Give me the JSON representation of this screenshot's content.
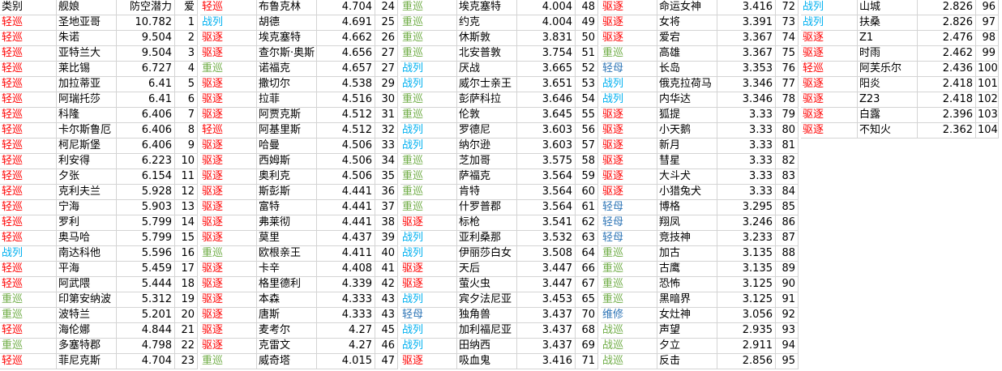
{
  "headers": [
    "类别",
    "舰娘",
    "防空潜力",
    "爱"
  ],
  "colors": {
    "轻巡": "#ff0000",
    "重巡": "#70ad47",
    "战列": "#00b0f0",
    "驱逐": "#ff0000",
    "轻母": "#2e75b6",
    "维修": "#2e75b6"
  },
  "blocks": [
    {
      "header": true,
      "rows": [
        [
          "轻巡",
          "圣地亚哥",
          "10.782",
          "1"
        ],
        [
          "轻巡",
          "朱诺",
          "9.504",
          "2"
        ],
        [
          "轻巡",
          "亚特兰大",
          "9.504",
          "3"
        ],
        [
          "轻巡",
          "莱比锡",
          "6.727",
          "4"
        ],
        [
          "轻巡",
          "加拉蒂亚",
          "6.41",
          "5"
        ],
        [
          "轻巡",
          "阿瑞托莎",
          "6.41",
          "6"
        ],
        [
          "轻巡",
          "科隆",
          "6.406",
          "7"
        ],
        [
          "轻巡",
          "卡尔斯鲁厄",
          "6.406",
          "8"
        ],
        [
          "轻巡",
          "柯尼斯堡",
          "6.406",
          "9"
        ],
        [
          "轻巡",
          "利安得",
          "6.223",
          "10"
        ],
        [
          "轻巡",
          "夕张",
          "6.154",
          "11"
        ],
        [
          "轻巡",
          "克利夫兰",
          "5.928",
          "12"
        ],
        [
          "轻巡",
          "宁海",
          "5.903",
          "13"
        ],
        [
          "轻巡",
          "罗利",
          "5.799",
          "14"
        ],
        [
          "轻巡",
          "奥马哈",
          "5.799",
          "15"
        ],
        [
          "战列",
          "南达科他",
          "5.596",
          "16"
        ],
        [
          "轻巡",
          "平海",
          "5.459",
          "17"
        ],
        [
          "轻巡",
          "阿武隈",
          "5.444",
          "18"
        ],
        [
          "重巡",
          "印第安纳波",
          "5.312",
          "19"
        ],
        [
          "重巡",
          "波特兰",
          "5.201",
          "20"
        ],
        [
          "轻巡",
          "海伦娜",
          "4.844",
          "21"
        ],
        [
          "重巡",
          "多塞特郡",
          "4.798",
          "22"
        ],
        [
          "轻巡",
          "菲尼克斯",
          "4.704",
          "23"
        ]
      ]
    },
    {
      "header": false,
      "rows": [
        [
          "轻巡",
          "布鲁克林",
          "4.704",
          "24"
        ],
        [
          "战列",
          "胡德",
          "4.691",
          "25"
        ],
        [
          "驱逐",
          "埃克塞特",
          "4.662",
          "26"
        ],
        [
          "驱逐",
          "查尔斯·奥斯",
          "4.656",
          "27"
        ],
        [
          "重巡",
          "诺福克",
          "4.657",
          "27"
        ],
        [
          "驱逐",
          "撒切尔",
          "4.538",
          "29"
        ],
        [
          "驱逐",
          "拉菲",
          "4.516",
          "30"
        ],
        [
          "驱逐",
          "阿贾克斯",
          "4.512",
          "31"
        ],
        [
          "轻巡",
          "阿基里斯",
          "4.512",
          "32"
        ],
        [
          "驱逐",
          "哈曼",
          "4.506",
          "33"
        ],
        [
          "驱逐",
          "西姆斯",
          "4.506",
          "34"
        ],
        [
          "驱逐",
          "奥利克",
          "4.506",
          "35"
        ],
        [
          "驱逐",
          "斯彭斯",
          "4.441",
          "36"
        ],
        [
          "驱逐",
          "富特",
          "4.441",
          "37"
        ],
        [
          "驱逐",
          "弗莱彻",
          "4.441",
          "38"
        ],
        [
          "驱逐",
          "莫里",
          "4.437",
          "39"
        ],
        [
          "重巡",
          "欧根亲王",
          "4.411",
          "40"
        ],
        [
          "驱逐",
          "卡辛",
          "4.408",
          "41"
        ],
        [
          "驱逐",
          "格里德利",
          "4.339",
          "42"
        ],
        [
          "驱逐",
          "本森",
          "4.333",
          "43"
        ],
        [
          "驱逐",
          "唐斯",
          "4.333",
          "43"
        ],
        [
          "驱逐",
          "麦考尔",
          "4.27",
          "45"
        ],
        [
          "驱逐",
          "克雷文",
          "4.27",
          "46"
        ],
        [
          "重巡",
          "威奇塔",
          "4.015",
          "47"
        ]
      ]
    },
    {
      "header": false,
      "rows": [
        [
          "重巡",
          "埃克塞特",
          "4.004",
          "48"
        ],
        [
          "重巡",
          "约克",
          "4.004",
          "49"
        ],
        [
          "重巡",
          "休斯敦",
          "3.831",
          "50"
        ],
        [
          "重巡",
          "北安普敦",
          "3.754",
          "51"
        ],
        [
          "战列",
          "厌战",
          "3.665",
          "52"
        ],
        [
          "战列",
          "威尔士亲王",
          "3.651",
          "53"
        ],
        [
          "重巡",
          "彭萨科拉",
          "3.646",
          "54"
        ],
        [
          "重巡",
          "伦敦",
          "3.645",
          "55"
        ],
        [
          "战列",
          "罗德尼",
          "3.603",
          "56"
        ],
        [
          "战列",
          "纳尔逊",
          "3.603",
          "57"
        ],
        [
          "重巡",
          "芝加哥",
          "3.575",
          "58"
        ],
        [
          "重巡",
          "萨福克",
          "3.564",
          "59"
        ],
        [
          "重巡",
          "肯特",
          "3.564",
          "60"
        ],
        [
          "重巡",
          "什罗普郡",
          "3.564",
          "61"
        ],
        [
          "驱逐",
          "标枪",
          "3.541",
          "62"
        ],
        [
          "战列",
          "亚利桑那",
          "3.532",
          "63"
        ],
        [
          "战列",
          "伊丽莎白女",
          "3.508",
          "64"
        ],
        [
          "驱逐",
          "天后",
          "3.447",
          "66"
        ],
        [
          "驱逐",
          "萤火虫",
          "3.447",
          "67"
        ],
        [
          "战列",
          "宾夕法尼亚",
          "3.453",
          "65"
        ],
        [
          "轻母",
          "独角兽",
          "3.437",
          "70"
        ],
        [
          "战列",
          "加利福尼亚",
          "3.437",
          "68"
        ],
        [
          "战列",
          "田纳西",
          "3.437",
          "69"
        ],
        [
          "驱逐",
          "吸血鬼",
          "3.416",
          "71"
        ]
      ]
    },
    {
      "header": false,
      "rows": [
        [
          "驱逐",
          "命运女神",
          "3.416",
          "72"
        ],
        [
          "驱逐",
          "女将",
          "3.391",
          "73"
        ],
        [
          "驱逐",
          "爱宕",
          "3.367",
          "74"
        ],
        [
          "重巡",
          "高雄",
          "3.367",
          "75"
        ],
        [
          "轻母",
          "长岛",
          "3.353",
          "76"
        ],
        [
          "战列",
          "俄克拉荷马",
          "3.346",
          "77"
        ],
        [
          "战列",
          "内华达",
          "3.346",
          "78"
        ],
        [
          "驱逐",
          "狐提",
          "3.33",
          "79"
        ],
        [
          "驱逐",
          "小天鹅",
          "3.33",
          "80"
        ],
        [
          "驱逐",
          "新月",
          "3.33",
          "81"
        ],
        [
          "驱逐",
          "彗星",
          "3.33",
          "82"
        ],
        [
          "驱逐",
          "大斗犬",
          "3.33",
          "83"
        ],
        [
          "驱逐",
          "小猎兔犬",
          "3.33",
          "84"
        ],
        [
          "轻母",
          "博格",
          "3.295",
          "85"
        ],
        [
          "轻母",
          "翔凤",
          "3.246",
          "86"
        ],
        [
          "轻母",
          "竞技神",
          "3.233",
          "87"
        ],
        [
          "重巡",
          "加古",
          "3.135",
          "88"
        ],
        [
          "重巡",
          "古鹰",
          "3.135",
          "89"
        ],
        [
          "重巡",
          "恐怖",
          "3.125",
          "90"
        ],
        [
          "重巡",
          "黑暗界",
          "3.125",
          "91"
        ],
        [
          "维修",
          "女灶神",
          "3.056",
          "92"
        ],
        [
          "战巡",
          "声望",
          "2.935",
          "93"
        ],
        [
          "战巡",
          "夕立",
          "2.911",
          "94"
        ],
        [
          "战巡",
          "反击",
          "2.856",
          "95"
        ]
      ]
    },
    {
      "header": false,
      "rows": [
        [
          "战列",
          "山城",
          "2.826",
          "96"
        ],
        [
          "战列",
          "扶桑",
          "2.826",
          "97"
        ],
        [
          "驱逐",
          "Z1",
          "2.476",
          "98"
        ],
        [
          "驱逐",
          "时雨",
          "2.462",
          "99"
        ],
        [
          "轻巡",
          "阿芙乐尔",
          "2.436",
          "100"
        ],
        [
          "驱逐",
          "阳炎",
          "2.418",
          "101"
        ],
        [
          "驱逐",
          "Z23",
          "2.418",
          "102"
        ],
        [
          "驱逐",
          "白露",
          "2.396",
          "103"
        ],
        [
          "驱逐",
          "不知火",
          "2.362",
          "104"
        ]
      ]
    }
  ]
}
